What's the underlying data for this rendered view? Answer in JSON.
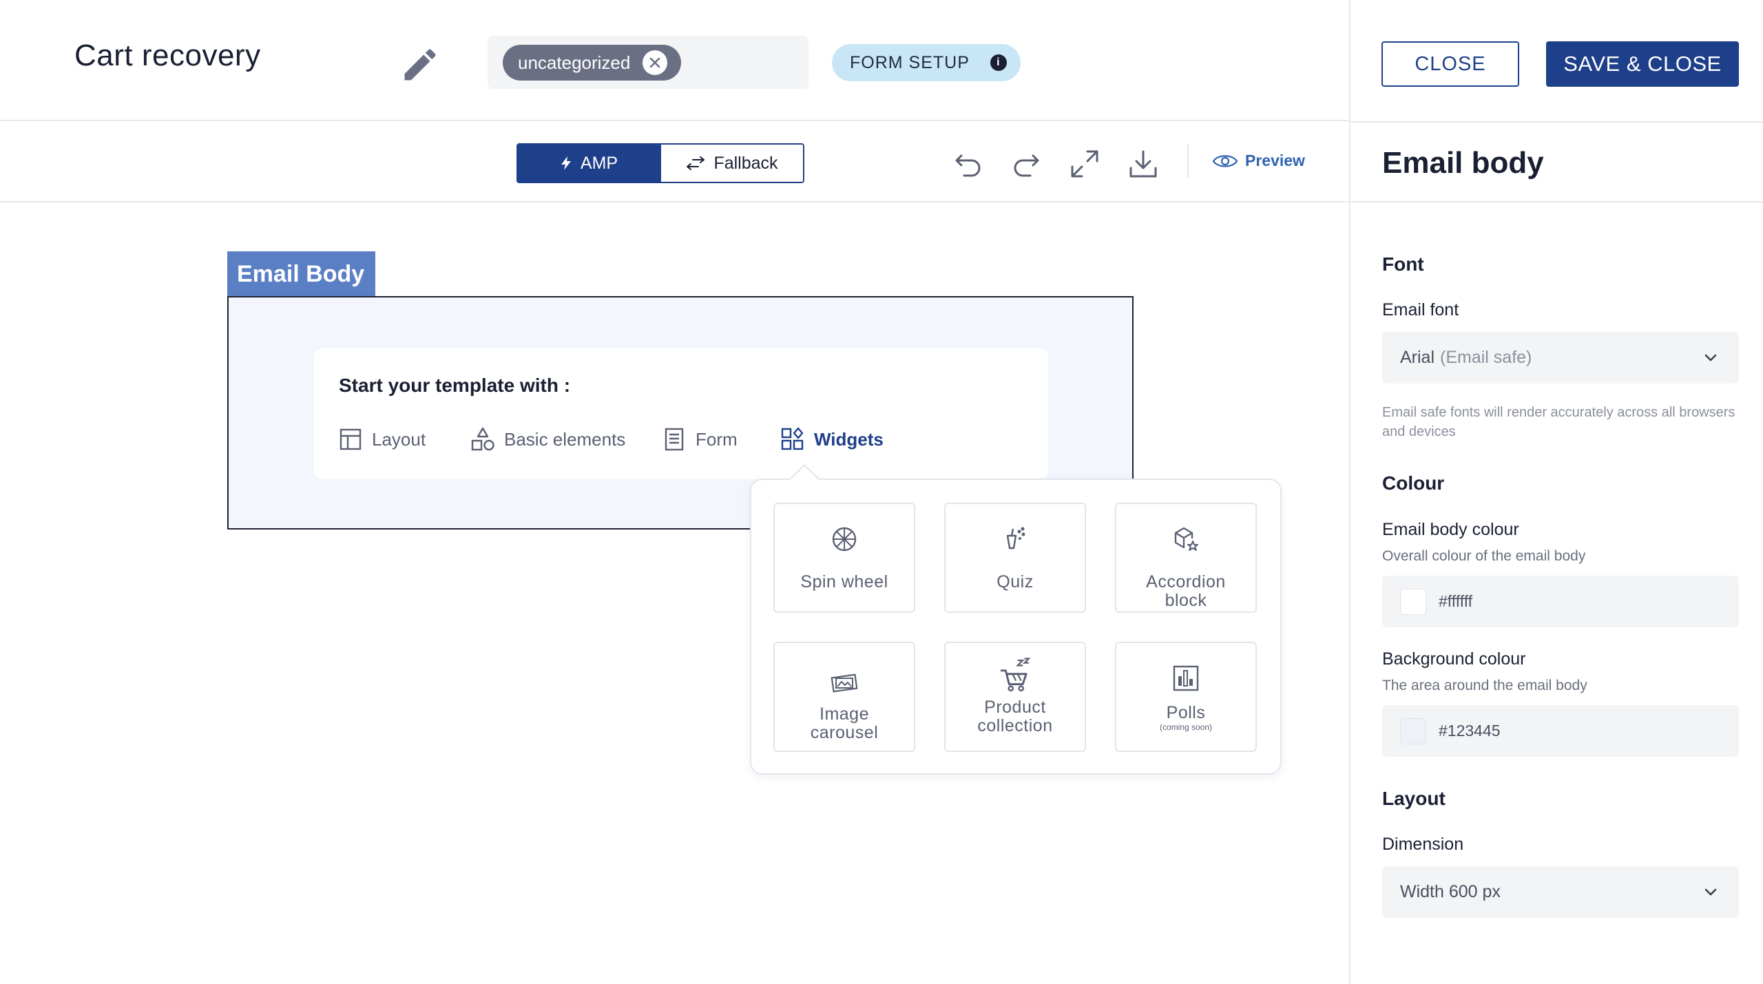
{
  "header": {
    "title": "Cart recovery",
    "tag": "uncategorized",
    "form_setup": "FORM SETUP",
    "info": "i"
  },
  "toolbar": {
    "amp": "AMP",
    "fallback": "Fallback",
    "preview": "Preview"
  },
  "canvas": {
    "label": "Email Body",
    "start_title": "Start your template with :",
    "options": [
      "Layout",
      "Basic elements",
      "Form",
      "Widgets"
    ],
    "active_option": "Widgets"
  },
  "widgets": [
    {
      "label": "Spin wheel",
      "icon": "spin-wheel-icon"
    },
    {
      "label": "Quiz",
      "icon": "quiz-icon"
    },
    {
      "label": "Accordion block",
      "line1": "Accordion",
      "line2": "block",
      "icon": "accordion-icon"
    },
    {
      "label": "Image carousel",
      "line1": "Image",
      "line2": "carousel",
      "icon": "image-carousel-icon"
    },
    {
      "label": "Product collection",
      "line1": "Product",
      "line2": "collection",
      "icon": "product-collection-icon"
    },
    {
      "label": "Polls",
      "sub": "(coming soon)",
      "icon": "polls-icon"
    }
  ],
  "panel": {
    "close": "CLOSE",
    "save_close": "SAVE & CLOSE",
    "title": "Email body",
    "font": {
      "heading": "Font",
      "label": "Email font",
      "value": "Arial",
      "value_note": "(Email safe)",
      "helper": "Email safe fonts will render accurately across all browsers and devices"
    },
    "colour": {
      "heading": "Colour",
      "body_label": "Email body colour",
      "body_sub": "Overall colour of the email body",
      "body_value": "#ffffff",
      "bg_label": "Background colour",
      "bg_sub": "The area around the email body",
      "bg_value": "#123445"
    },
    "layout": {
      "heading": "Layout",
      "label": "Dimension",
      "value": "Width 600 px"
    }
  },
  "colors": {
    "primary": "#1e3f8a",
    "canvas_label": "#5a7fc4",
    "canvas_bg": "#f3f6fd",
    "chip": "#6b6f84",
    "form_setup_bg": "#c9e6f6",
    "preview_link": "#2f63b0",
    "bg_swatch": "#eef2f8"
  }
}
